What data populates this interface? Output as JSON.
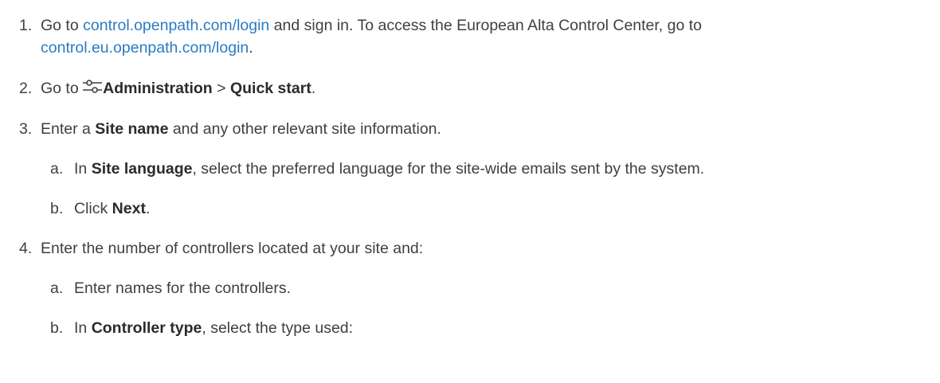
{
  "steps": [
    {
      "number": "1.",
      "text_a": "Go to ",
      "link1": "control.openpath.com/login",
      "text_b": " and sign in. To access the European Alta Control Center, go to",
      "link2": "control.eu.openpath.com/login",
      "text_c": "."
    },
    {
      "number": "2.",
      "text_a": "Go to ",
      "icon": "administration-sliders-icon",
      "bold1": "Administration",
      "sep": " > ",
      "bold2": "Quick start",
      "text_end": "."
    },
    {
      "number": "3.",
      "text_a": "Enter a ",
      "bold1": "Site name",
      "text_b": " and any other relevant site information.",
      "substeps": [
        {
          "letter": "a.",
          "text_a": "In ",
          "bold1": "Site language",
          "text_b": ", select the preferred language for the site-wide emails sent by the system."
        },
        {
          "letter": "b.",
          "text_a": "Click ",
          "bold1": "Next",
          "text_b": "."
        }
      ]
    },
    {
      "number": "4.",
      "text_a": "Enter the number of controllers located at your site and:",
      "substeps": [
        {
          "letter": "a.",
          "text_a": "Enter names for the controllers."
        },
        {
          "letter": "b.",
          "text_a": "In ",
          "bold1": "Controller type",
          "text_b": ", select the type used:"
        }
      ]
    }
  ]
}
